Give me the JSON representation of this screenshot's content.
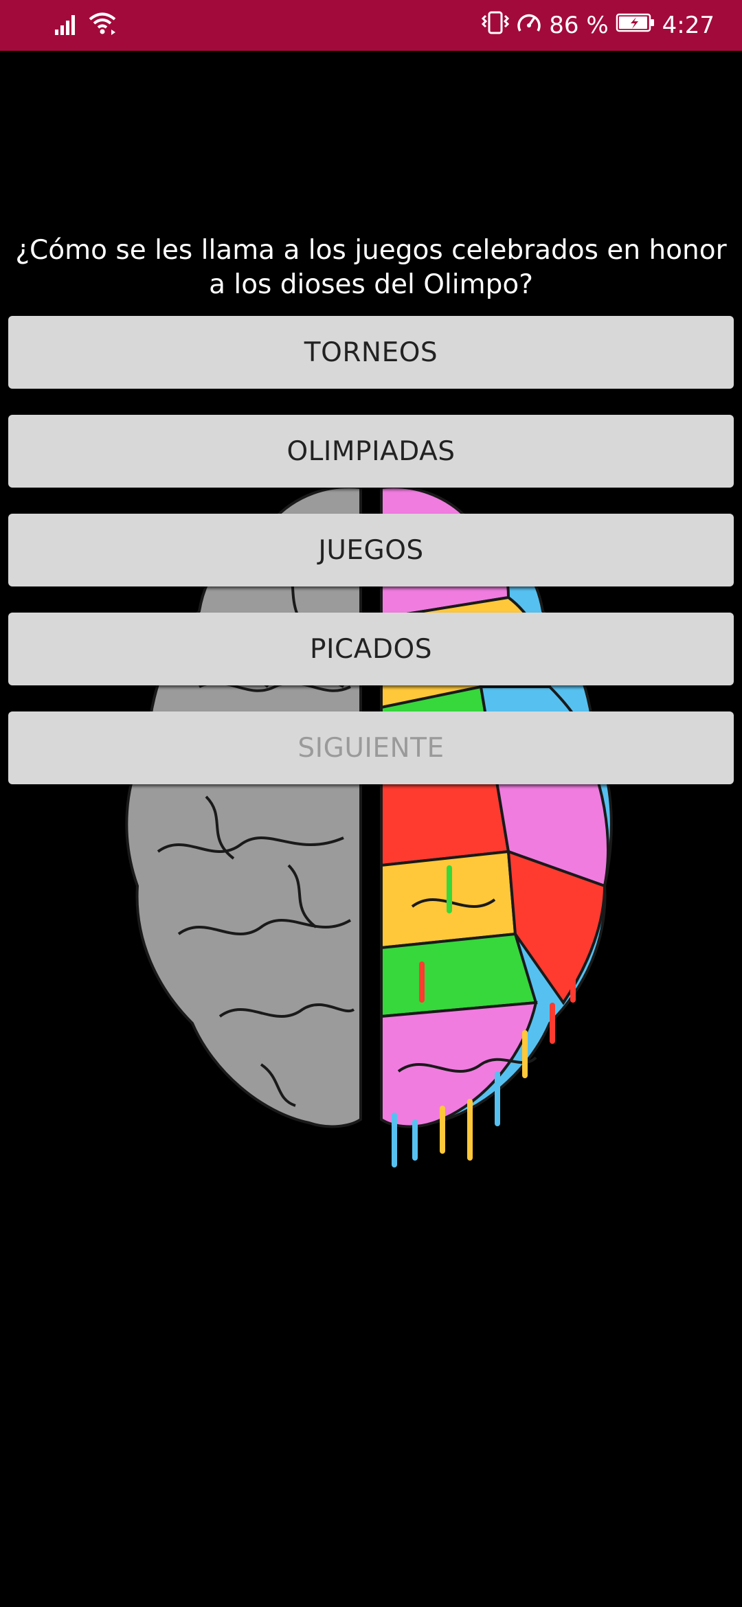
{
  "status_bar": {
    "battery_percent": "86 %",
    "time": "4:27",
    "icons": [
      "signal-icon",
      "wifi-icon",
      "vibrate-icon",
      "data-saver-icon",
      "battery-charging-icon"
    ],
    "color": "#a30a3c"
  },
  "quiz": {
    "question": "¿Cómo se les llama a los juegos celebrados en honor a los dioses del Olimpo?",
    "answers": [
      "TORNEOS",
      "OLIMPIADAS",
      "JUEGOS",
      "PICADOS"
    ],
    "next_label": "SIGUIENTE"
  },
  "background": {
    "image": "brain-illustration",
    "colors": [
      "#9b9b9b",
      "#f07ce0",
      "#36d83b",
      "#56c1f0",
      "#ff3b30",
      "#ffc83a"
    ]
  }
}
